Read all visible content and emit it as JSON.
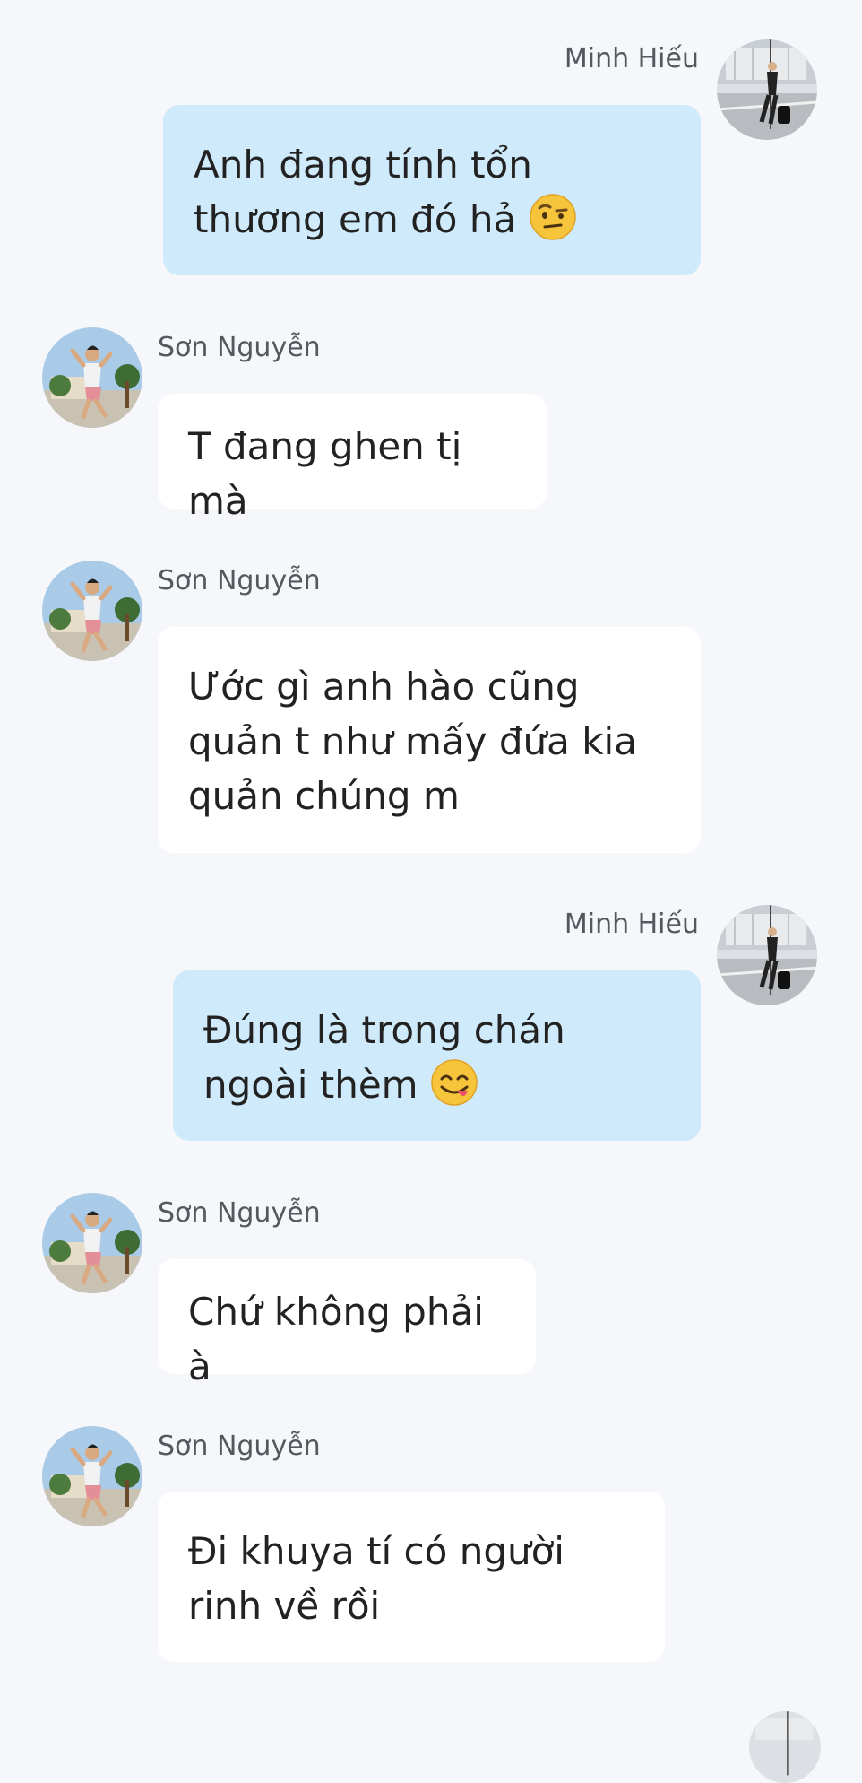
{
  "conversation": {
    "messages": [
      {
        "sender": "Minh Hiếu",
        "side": "right",
        "text": "Anh đang tính tổn thương em đó hả",
        "emoji": "raised-eyebrow-emoji"
      },
      {
        "sender": "Sơn Nguyễn",
        "side": "left",
        "text": "T đang ghen tị mà"
      },
      {
        "sender": "Sơn Nguyễn",
        "side": "left",
        "text": "Ước gì anh hào cũng quản t như mấy đứa kia quản chúng m"
      },
      {
        "sender": "Minh Hiếu",
        "side": "right",
        "text": "Đúng là trong chán ngoài thèm",
        "emoji": "yum-emoji"
      },
      {
        "sender": "Sơn Nguyễn",
        "side": "left",
        "text": "Chứ không phải à"
      },
      {
        "sender": "Sơn Nguyễn",
        "side": "left",
        "text": "Đi khuya tí có người rinh về rồi"
      }
    ]
  },
  "colors": {
    "background": "#f5f7fa",
    "my_bubble": "#cfeafa",
    "other_bubble": "#ffffff",
    "name_text": "#55595f"
  }
}
